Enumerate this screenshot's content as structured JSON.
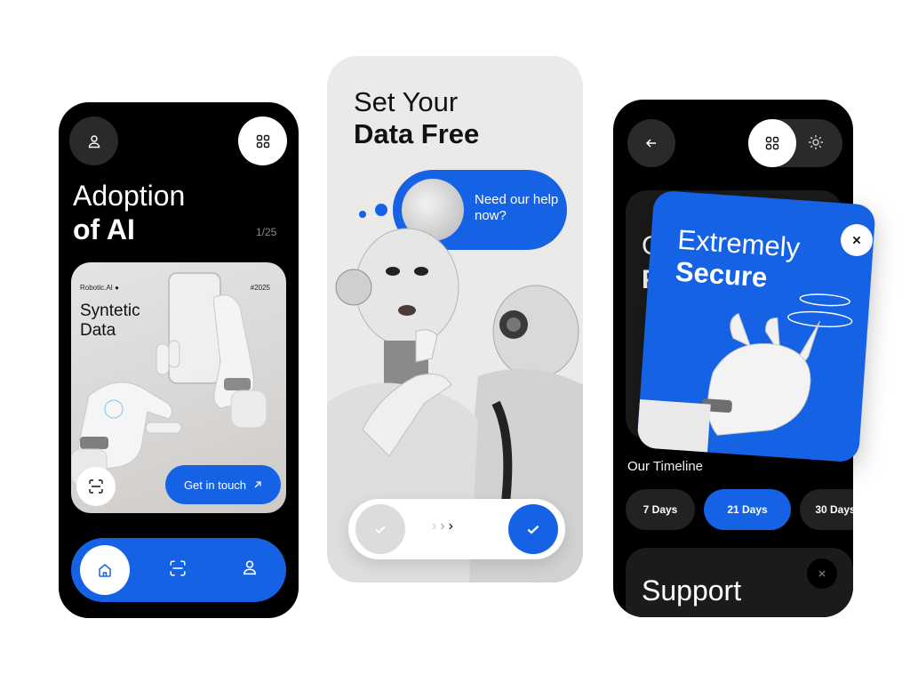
{
  "brand_color": "#1562e5",
  "phone1": {
    "title_line1": "Adoption",
    "title_line2": "of AI",
    "counter": "1/25",
    "card": {
      "brand": "Robotic.AI",
      "tag": "#2025",
      "title": "Syntetic Data",
      "cta_label": "Get in touch"
    },
    "icons": [
      "user-icon",
      "grid-icon",
      "scan-icon",
      "arrow-up-right-icon",
      "home-icon",
      "user-icon"
    ]
  },
  "phone2": {
    "title_line1": "Set Your",
    "title_line2": "Data Free",
    "bubble_text": "Need our help now?",
    "slider_arrows": [
      "›",
      "›",
      "›"
    ]
  },
  "phone3": {
    "bg_card_line1": "G",
    "bg_card_line2": "P",
    "timeline_label": "Our Timeline",
    "pills": [
      "7 Days",
      "21 Days",
      "30 Days"
    ],
    "active_pill": "21 Days",
    "support_label": "Support"
  },
  "secure_card": {
    "title_line1": "Extremely",
    "title_line2": "Secure"
  }
}
